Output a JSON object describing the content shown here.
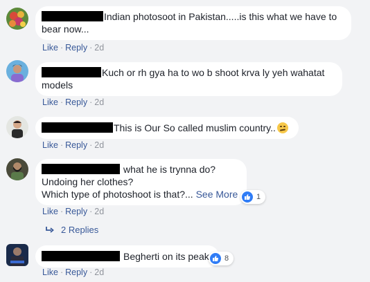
{
  "action_labels": {
    "like": "Like",
    "reply": "Reply",
    "separator": "·"
  },
  "colors": {
    "link": "#385898",
    "background": "#f2f3f5",
    "like_badge": "#2f7cf6"
  },
  "comments": [
    {
      "text": "Indian photosoot in Pakistan.....is this what we have to",
      "text2": "bear now...",
      "time": "2d"
    },
    {
      "text": "Kuch or rh gya ha to wo b shoot krva ly yeh wahatat",
      "text2": "models",
      "time": "2d"
    },
    {
      "text": "This is Our So called muslim country..",
      "emoji": "smirk-emoji",
      "time": "2d"
    },
    {
      "text": "what he is trynna do?",
      "text2": "Undoing her clothes?",
      "text3": "Which type of photoshoot is that?...",
      "see_more": "See More",
      "reaction_count": "1",
      "time": "2d",
      "replies": "2 Replies"
    },
    {
      "text": "Begherti on its peak",
      "reaction_count": "8",
      "time": "2d"
    }
  ]
}
